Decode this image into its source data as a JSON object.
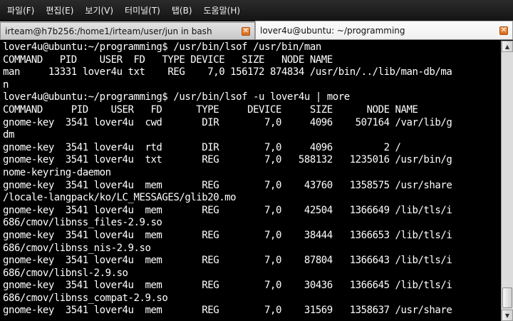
{
  "menubar": {
    "items": [
      "파일(F)",
      "편집(E)",
      "보기(V)",
      "터미널(T)",
      "탭(B)",
      "도움말(H)"
    ]
  },
  "tabs": [
    {
      "title": "irteam@h7b256:/home1/irteam/user/jun in bash",
      "active": false
    },
    {
      "title": "lover4u@ubuntu: ~/programming",
      "active": true
    }
  ],
  "terminal": {
    "lines": [
      "lover4u@ubuntu:~/programming$ /usr/bin/lsof /usr/bin/man",
      "COMMAND   PID    USER  FD   TYPE DEVICE   SIZE   NODE NAME",
      "man     13331 lover4u txt    REG    7,0 156172 874834 /usr/bin/../lib/man-db/ma",
      "n",
      "lover4u@ubuntu:~/programming$ /usr/bin/lsof -u lover4u | more",
      "COMMAND     PID    USER   FD      TYPE     DEVICE     SIZE      NODE NAME",
      "gnome-key  3541 lover4u  cwd       DIR        7,0     4096    507164 /var/lib/g",
      "dm",
      "gnome-key  3541 lover4u  rtd       DIR        7,0     4096         2 /",
      "gnome-key  3541 lover4u  txt       REG        7,0   588132   1235016 /usr/bin/g",
      "nome-keyring-daemon",
      "gnome-key  3541 lover4u  mem       REG        7,0    43760   1358575 /usr/share",
      "/locale-langpack/ko/LC_MESSAGES/glib20.mo",
      "gnome-key  3541 lover4u  mem       REG        7,0    42504   1366649 /lib/tls/i",
      "686/cmov/libnss_files-2.9.so",
      "gnome-key  3541 lover4u  mem       REG        7,0    38444   1366653 /lib/tls/i",
      "686/cmov/libnss_nis-2.9.so",
      "gnome-key  3541 lover4u  mem       REG        7,0    87804   1366643 /lib/tls/i",
      "686/cmov/libnsl-2.9.so",
      "gnome-key  3541 lover4u  mem       REG        7,0    30436   1366645 /lib/tls/i",
      "686/cmov/libnss_compat-2.9.so",
      "gnome-key  3541 lover4u  mem       REG        7,0    31569   1358637 /usr/share"
    ]
  },
  "icons": {
    "tab_close": "close-icon",
    "scroll_up": "arrow-up-icon",
    "scroll_down": "arrow-down-icon"
  },
  "colors": {
    "tab_close": "#e07a2a",
    "terminal_bg": "#000000",
    "terminal_fg": "#ffffff"
  }
}
